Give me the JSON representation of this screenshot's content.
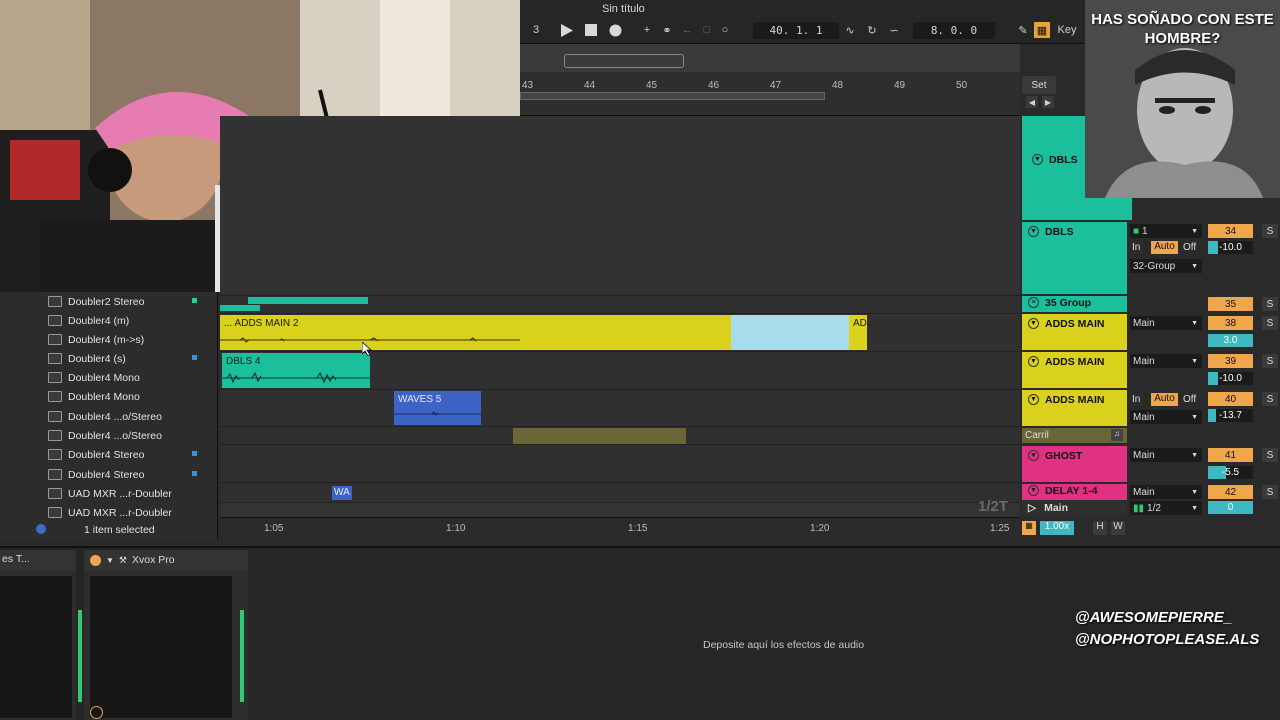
{
  "transport": {
    "title": "Sin título",
    "bar_count": "3",
    "position": "40.  1.  1",
    "loop_length": "8.  0.  0",
    "key_label": "Key"
  },
  "ruler": {
    "ticks": [
      "43",
      "44",
      "45",
      "46",
      "47",
      "48",
      "49",
      "50"
    ],
    "set_label": "Set"
  },
  "browser": {
    "items": [
      {
        "label": "Doubler2 Stereo",
        "dot": "#2ecc9a"
      },
      {
        "label": "Doubler4 (m)",
        "dot": ""
      },
      {
        "label": "Doubler4 (m->s)",
        "dot": ""
      },
      {
        "label": "Doubler4 (s)",
        "dot": "#3a8fe0"
      },
      {
        "label": "Doubler4 Mono",
        "dot": ""
      },
      {
        "label": "Doubler4 Mono",
        "dot": ""
      },
      {
        "label": "Doubler4 ...o/Stereo",
        "dot": ""
      },
      {
        "label": "Doubler4 ...o/Stereo",
        "dot": ""
      },
      {
        "label": "Doubler4 Stereo",
        "dot": "#3a8fe0"
      },
      {
        "label": "Doubler4 Stereo",
        "dot": "#3a8fe0"
      },
      {
        "label": "UAD MXR ...r-Doubler",
        "dot": ""
      },
      {
        "label": "UAD MXR ...r-Doubler",
        "dot": ""
      }
    ],
    "status": "1 item selected"
  },
  "clips": {
    "adds_main": "... ADDS MAIN 2",
    "adds_main_tail": "AD",
    "dbls": "DBLS 4",
    "waves": "WAVES 5",
    "wa": "WA"
  },
  "timeline": {
    "ticks": [
      "1:05",
      "1:10",
      "1:15",
      "1:20",
      "1:25"
    ],
    "grid_label": "1/2T"
  },
  "tracks": {
    "dbls_top": {
      "name": "DBLS"
    },
    "dbls": {
      "name": "DBLS",
      "input": "1",
      "in": "In",
      "auto": "Auto",
      "off": "Off",
      "route": "32-Group",
      "number": "34",
      "volume": "-10.0"
    },
    "group35": {
      "name": "35 Group",
      "number": "35"
    },
    "adds1": {
      "name": "ADDS MAIN",
      "route": "Main",
      "number": "38",
      "volume": "3.0"
    },
    "adds2": {
      "name": "ADDS MAIN",
      "route": "Main",
      "number": "39",
      "volume": "-10.0"
    },
    "adds3": {
      "name": "ADDS MAIN",
      "in": "In",
      "auto": "Auto",
      "off": "Off",
      "route": "Main",
      "number": "40",
      "volume": "-13.7"
    },
    "carril": {
      "name": "Carril"
    },
    "ghost": {
      "name": "GHOST",
      "route": "Main",
      "number": "41",
      "volume": "-5.5"
    },
    "delay": {
      "name": "DELAY 1-4",
      "route": "Main",
      "number": "42"
    },
    "main": {
      "name": "Main",
      "route": "1/2",
      "volume": "0"
    },
    "solo": "S",
    "zoom": "1.00x",
    "h": "H",
    "w": "W"
  },
  "devices": {
    "left_title": "es T...",
    "xvox": "Xvox Pro",
    "dropzone": "Deposite aquí los efectos de audio"
  },
  "overlay": {
    "caption": "HAS SOÑADO CON ESTE HOMBRE?",
    "handle1": "@AWESOMEPIERRE_",
    "handle2": "@NOPHOTOPLEASE.ALS"
  },
  "colors": {
    "teal": "#1bbf9b",
    "yellow": "#d9d11b",
    "lightblue": "#a9dcea",
    "blue": "#3d63c7",
    "olive": "#6b6638",
    "pink": "#e03183",
    "orange": "#f0a64a",
    "tealtext": "#3fb9c1"
  }
}
